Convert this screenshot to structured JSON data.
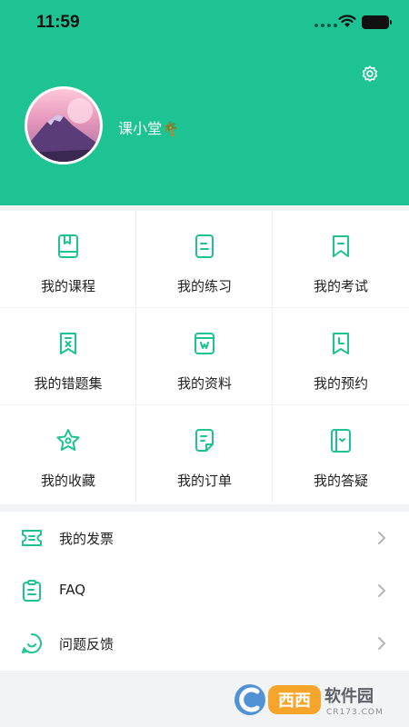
{
  "status_bar": {
    "time": "11:59"
  },
  "profile": {
    "username": "课小堂",
    "username_emoji": "🌴"
  },
  "grid_items": [
    {
      "label": "我的课程",
      "icon": "book-icon"
    },
    {
      "label": "我的练习",
      "icon": "practice-icon"
    },
    {
      "label": "我的考试",
      "icon": "exam-bookmark-icon"
    },
    {
      "label": "我的错题集",
      "icon": "wrong-questions-icon"
    },
    {
      "label": "我的资料",
      "icon": "materials-icon"
    },
    {
      "label": "我的预约",
      "icon": "appointment-icon"
    },
    {
      "label": "我的收藏",
      "icon": "star-icon"
    },
    {
      "label": "我的订单",
      "icon": "order-icon"
    },
    {
      "label": "我的答疑",
      "icon": "qa-icon"
    }
  ],
  "list_items": [
    {
      "label": "我的发票",
      "icon": "invoice-icon"
    },
    {
      "label": "FAQ",
      "icon": "faq-clipboard-icon"
    },
    {
      "label": "问题反馈",
      "icon": "feedback-icon"
    }
  ],
  "watermark": {
    "brand": "西西软件园",
    "domain": "CR173.COM"
  },
  "colors": {
    "primary": "#1dc393",
    "background": "#f2f3f5",
    "text": "#222222"
  }
}
